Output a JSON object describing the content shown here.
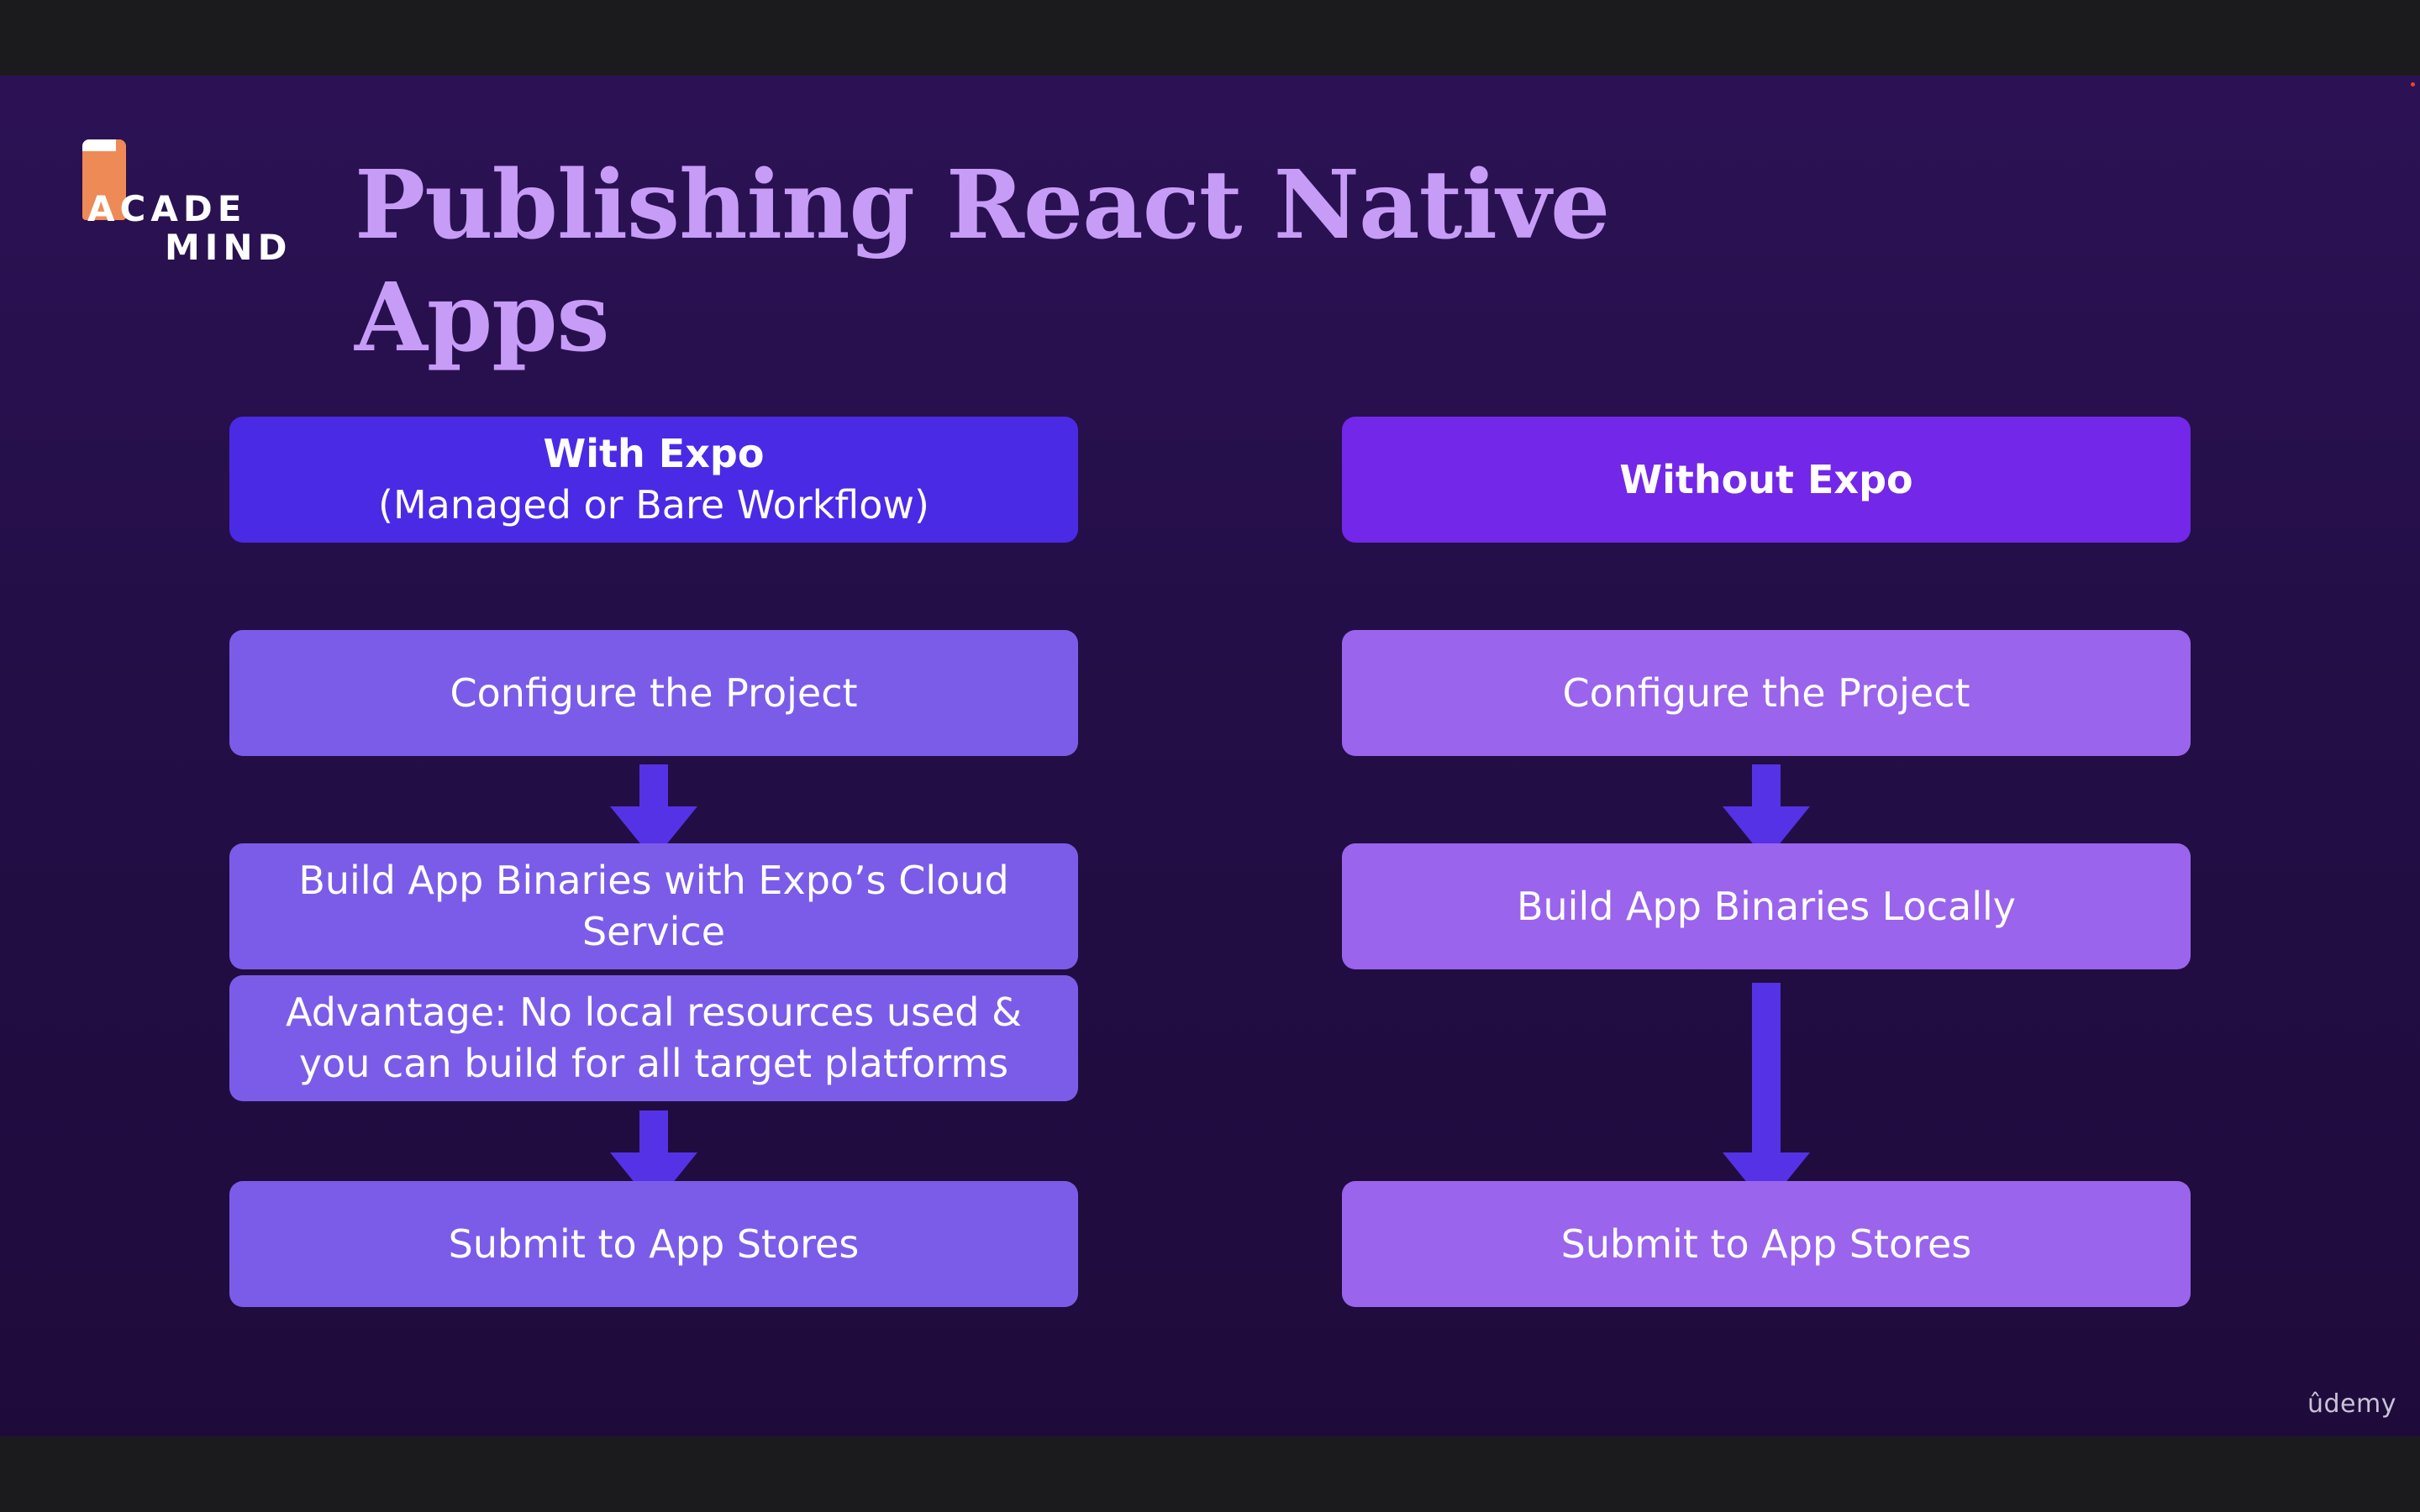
{
  "logo": {
    "line1": "ACADE",
    "line2": "MIND"
  },
  "title": "Publishing React Native Apps",
  "left_column": {
    "header_title": "With Expo",
    "header_subtitle": "(Managed or Bare Workflow)",
    "step1": "Configure the Project",
    "step2": "Build App Binaries with Expo’s Cloud Service",
    "note": "Advantage: No local resources used & you can build for all target platforms",
    "step3": "Submit to App Stores"
  },
  "right_column": {
    "header_title": "Without Expo",
    "step1": "Configure the Project",
    "step2": "Build App Binaries Locally",
    "step3": "Submit to App Stores"
  },
  "watermark": "ûdemy",
  "colors": {
    "title": "#c79cf6",
    "left_header": "#4b2ae6",
    "right_header": "#7327e8",
    "left_box": "#7b5ce8",
    "right_box": "#9a64ec",
    "arrow": "#5532e6",
    "logo_accent": "#ee8a55"
  }
}
